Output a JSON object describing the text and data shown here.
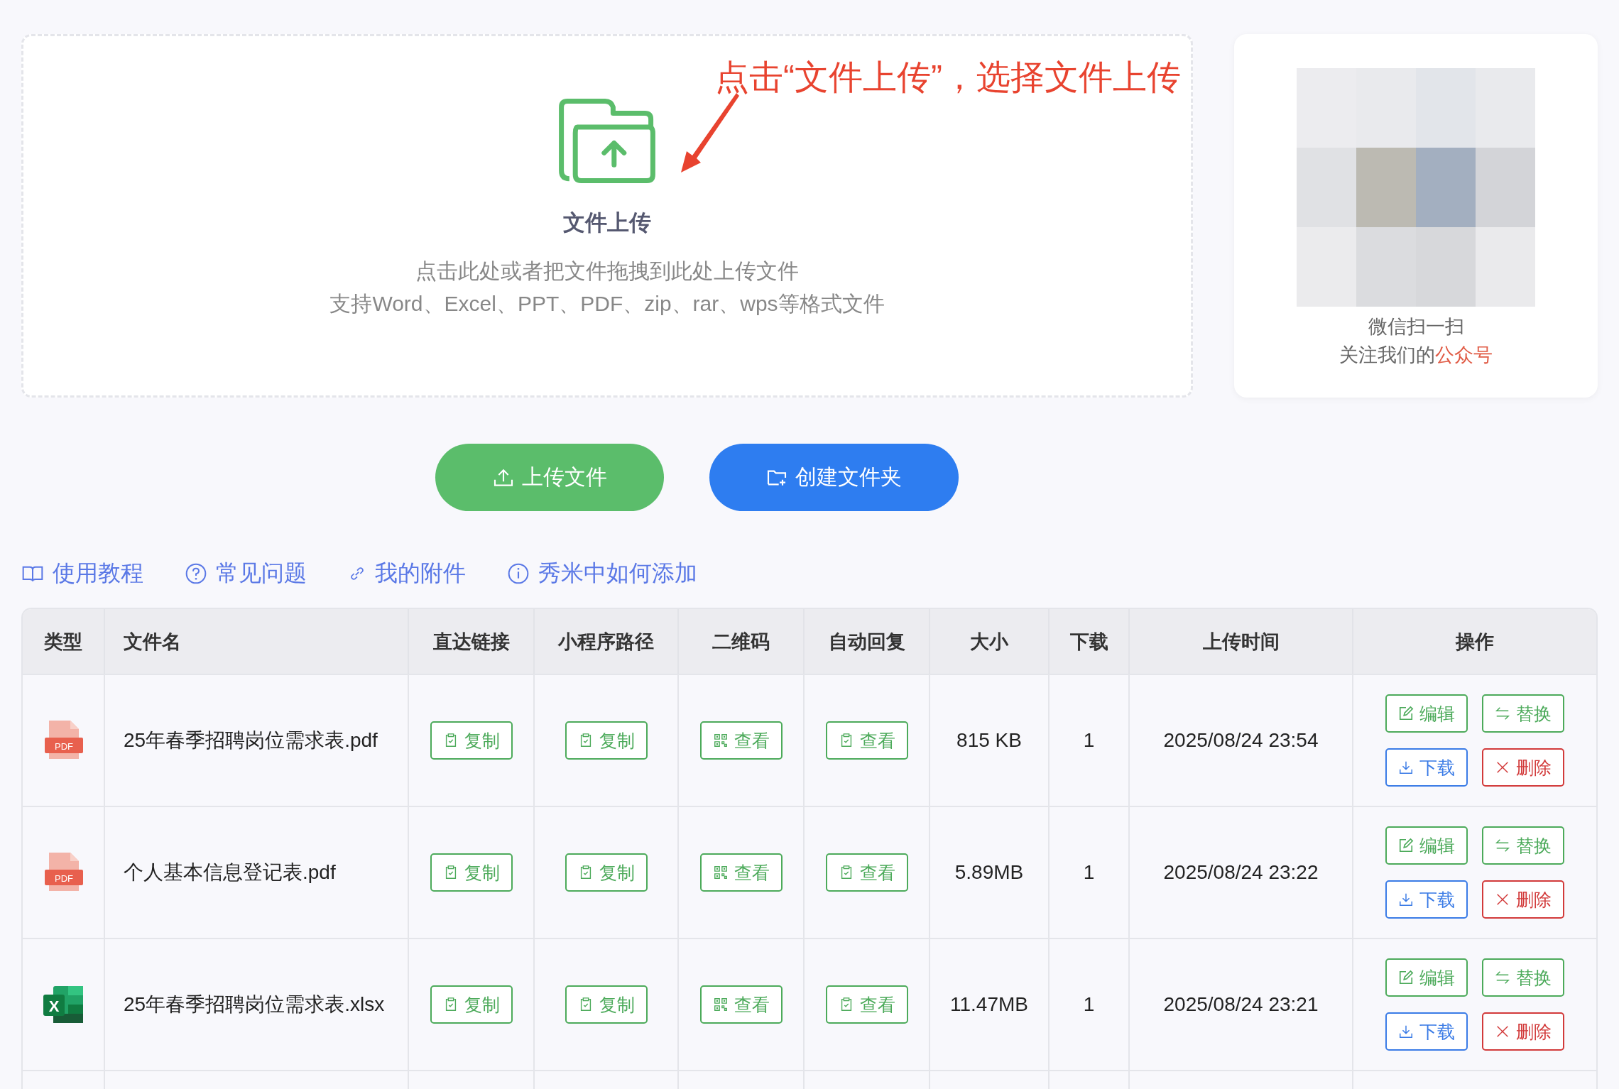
{
  "upload_area": {
    "annotation": "点击“文件上传”，选择文件上传",
    "title": "文件上传",
    "description_lines": [
      "点击此处或者把文件拖拽到此处上传文件",
      "支持Word、Excel、PPT、PDF、zip、rar、wps等格式文件"
    ]
  },
  "qr_card": {
    "caption": "微信扫一扫",
    "follow_text": "关注我们的",
    "follow_highlight": "公众号"
  },
  "actions": [
    {
      "label": "上传文件",
      "kind": "upload"
    },
    {
      "label": "创建文件夹",
      "kind": "folder"
    }
  ],
  "links": [
    {
      "label": "使用教程",
      "kind": "book"
    },
    {
      "label": "常见问题",
      "kind": "help"
    },
    {
      "label": "我的附件",
      "kind": "link"
    },
    {
      "label": "秀米中如何添加",
      "kind": "info"
    }
  ],
  "table": {
    "columns": [
      "类型",
      "文件名",
      "直达链接",
      "小程序路径",
      "二维码",
      "自动回复",
      "大小",
      "下载",
      "上传时间",
      "操作"
    ],
    "rows": [
      {
        "cells": [
          {
            "kind": "pdf",
            "text": "PDF"
          },
          {
            "kind": "text",
            "text": "25年春季招聘岗位需求表.pdf"
          },
          {
            "kind": "copy",
            "text": "复制"
          },
          {
            "kind": "copy",
            "text": "复制"
          },
          {
            "kind": "qr",
            "text": "查看"
          },
          {
            "kind": "copy",
            "text": "查看"
          },
          {
            "kind": "text",
            "text": "815 KB"
          },
          {
            "kind": "text",
            "text": "1"
          },
          {
            "kind": "text",
            "text": "2025/08/24 23:54"
          },
          {
            "kind": "ops",
            "operations": [
              {
                "label": "编辑",
                "kind": "edit"
              },
              {
                "label": "替换",
                "kind": "replace"
              },
              {
                "label": "下载",
                "kind": "download"
              },
              {
                "label": "删除",
                "kind": "delete"
              }
            ]
          }
        ]
      },
      {
        "cells": [
          {
            "kind": "pdf",
            "text": "PDF"
          },
          {
            "kind": "text",
            "text": "个人基本信息登记表.pdf"
          },
          {
            "kind": "copy",
            "text": "复制"
          },
          {
            "kind": "copy",
            "text": "复制"
          },
          {
            "kind": "qr",
            "text": "查看"
          },
          {
            "kind": "copy",
            "text": "查看"
          },
          {
            "kind": "text",
            "text": "5.89MB"
          },
          {
            "kind": "text",
            "text": "1"
          },
          {
            "kind": "text",
            "text": "2025/08/24 23:22"
          },
          {
            "kind": "ops",
            "operations": [
              {
                "label": "编辑",
                "kind": "edit"
              },
              {
                "label": "替换",
                "kind": "replace"
              },
              {
                "label": "下载",
                "kind": "download"
              },
              {
                "label": "删除",
                "kind": "delete"
              }
            ]
          }
        ]
      },
      {
        "cells": [
          {
            "kind": "xlsx",
            "text": "X"
          },
          {
            "kind": "text",
            "text": "25年春季招聘岗位需求表.xlsx"
          },
          {
            "kind": "copy",
            "text": "复制"
          },
          {
            "kind": "copy",
            "text": "复制"
          },
          {
            "kind": "qr",
            "text": "查看"
          },
          {
            "kind": "copy",
            "text": "查看"
          },
          {
            "kind": "text",
            "text": "11.47MB"
          },
          {
            "kind": "text",
            "text": "1"
          },
          {
            "kind": "text",
            "text": "2025/08/24 23:21"
          },
          {
            "kind": "ops",
            "operations": [
              {
                "label": "编辑",
                "kind": "edit"
              },
              {
                "label": "替换",
                "kind": "replace"
              },
              {
                "label": "下载",
                "kind": "download"
              },
              {
                "label": "删除",
                "kind": "delete"
              }
            ]
          }
        ]
      }
    ]
  }
}
